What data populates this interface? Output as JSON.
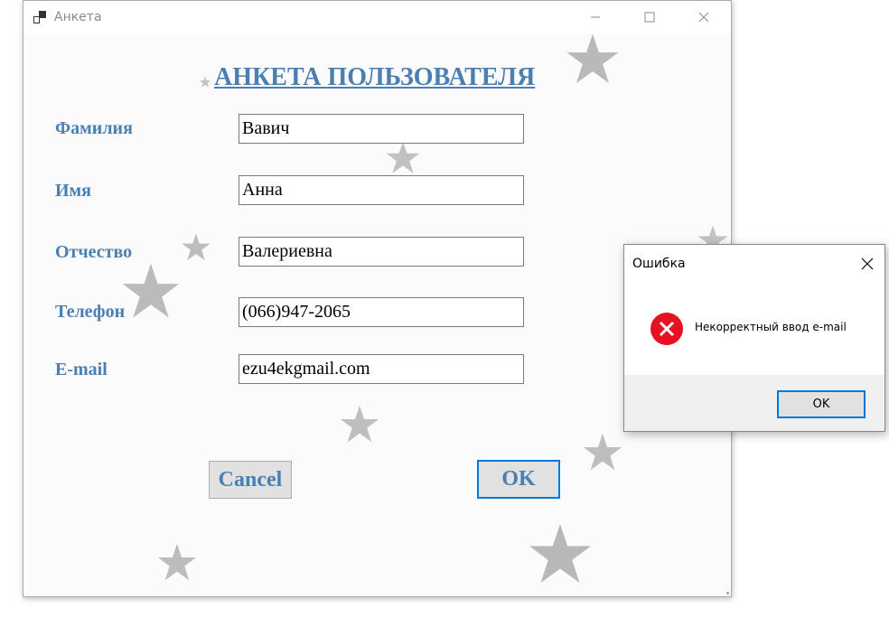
{
  "window": {
    "title": "Анкета",
    "icon": "app-window-icon",
    "controls": [
      "minimize-icon",
      "maximize-icon",
      "close-icon"
    ]
  },
  "form": {
    "heading": "АНКЕТА ПОЛЬЗОВАТЕЛЯ",
    "fields": [
      {
        "label": "Фамилия",
        "value": "Вавич"
      },
      {
        "label": "Имя",
        "value": "Анна"
      },
      {
        "label": "Отчество",
        "value": "Валериевна"
      },
      {
        "label": "Телефон",
        "value": "(066)947-2065"
      },
      {
        "label": "E-mail",
        "value": "ezu4ekgmail.com"
      }
    ],
    "cancel_label": "Cancel",
    "ok_label": "OK",
    "colors": {
      "accent": "#4a7fb4",
      "focus_border": "#0078d7",
      "background": "#fbfbfb"
    },
    "background_decoration": "silver-glitter-stars"
  },
  "dialog": {
    "title": "Ошибка",
    "message": "Некорректный ввод e-mail",
    "icon": "error-icon",
    "ok_label": "OK",
    "error_color": "#e81123"
  }
}
